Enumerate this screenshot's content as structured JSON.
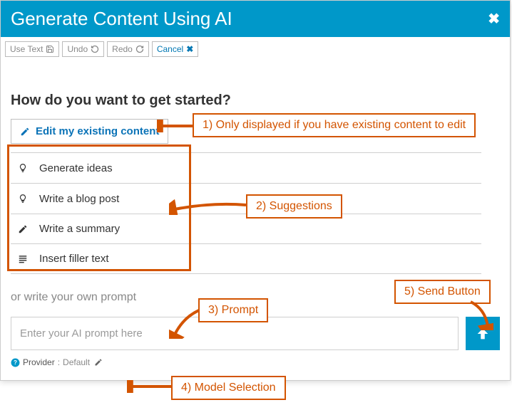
{
  "dialog": {
    "title": "Generate Content Using AI"
  },
  "toolbar": {
    "use_text": "Use Text",
    "undo": "Undo",
    "redo": "Redo",
    "cancel": "Cancel"
  },
  "question": "How do you want to get started?",
  "primary_action": "Edit my existing content",
  "suggestions": [
    {
      "icon": "lightbulb",
      "label": "Generate ideas"
    },
    {
      "icon": "lightbulb",
      "label": "Write a blog post"
    },
    {
      "icon": "pencil",
      "label": "Write a summary"
    },
    {
      "icon": "lines",
      "label": "Insert filler text"
    }
  ],
  "or_text": "or write your own prompt",
  "prompt": {
    "placeholder": "Enter your AI prompt here",
    "value": ""
  },
  "provider": {
    "label": "Provider",
    "value": "Default"
  },
  "annotations": {
    "a1": "1) Only displayed if you have existing content to edit",
    "a2": "2) Suggestions",
    "a3": "3) Prompt",
    "a4": "4) Model Selection",
    "a5": "5) Send Button"
  }
}
